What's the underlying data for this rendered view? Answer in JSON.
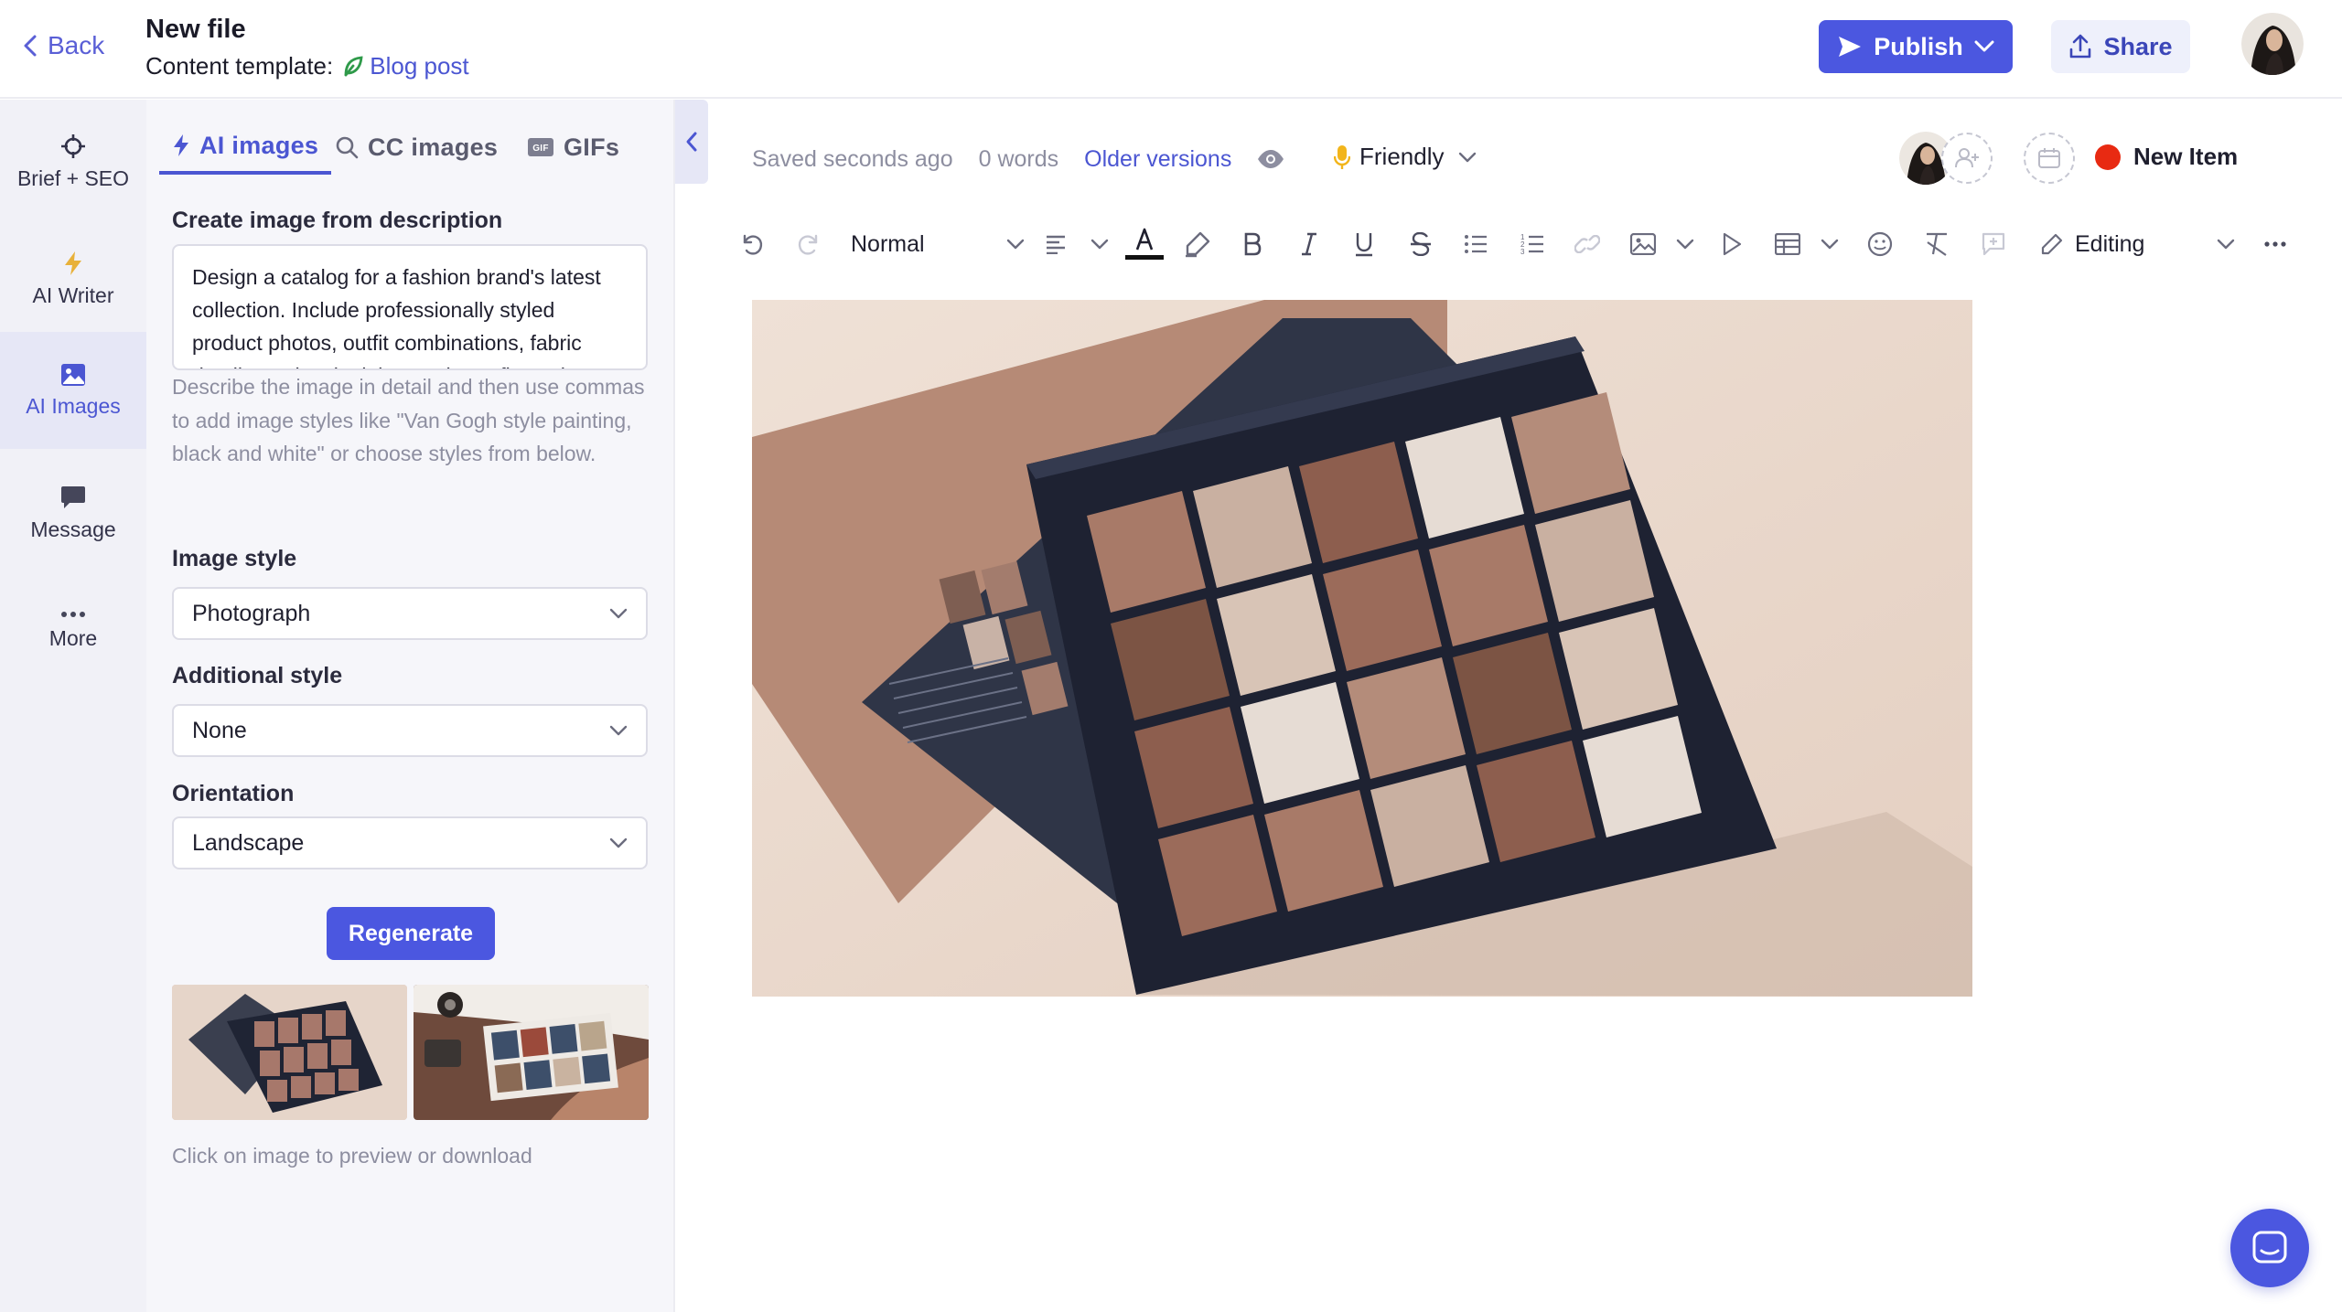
{
  "header": {
    "back_label": "Back",
    "file_title": "New file",
    "template_label": "Content template:",
    "template_name": "Blog post",
    "publish_label": "Publish",
    "share_label": "Share"
  },
  "leftnav": {
    "items": [
      {
        "label": "Brief + SEO",
        "icon": "crosshair-icon"
      },
      {
        "label": "AI Writer",
        "icon": "lightning-icon"
      },
      {
        "label": "AI Images",
        "icon": "image-icon",
        "active": true
      },
      {
        "label": "Message",
        "icon": "chat-bubble-icon"
      },
      {
        "label": "More",
        "icon": "more-dots-icon"
      }
    ]
  },
  "panel": {
    "tabs": [
      {
        "label": "AI images",
        "icon": "lightning-icon",
        "active": true
      },
      {
        "label": "CC images",
        "icon": "search-icon"
      },
      {
        "label": "GIFs",
        "icon": "gif-icon"
      }
    ],
    "create_label": "Create image from description",
    "description_value": "Design a catalog for a fashion brand's latest collection. Include professionally styled product photos, outfit combinations, fabric details, and a sleek layout that reflects the",
    "hint": "Describe the image in detail and then use commas to add image styles like \"Van Gogh style painting, black and white\" or choose styles from below.",
    "image_style_label": "Image style",
    "image_style_value": "Photograph",
    "additional_style_label": "Additional style",
    "additional_style_value": "None",
    "orientation_label": "Orientation",
    "orientation_value": "Landscape",
    "regenerate_label": "Regenerate",
    "click_hint": "Click on image to preview or download"
  },
  "editor": {
    "saved_status": "Saved seconds ago",
    "word_count": "0 words",
    "older_versions": "Older versions",
    "tone": "Friendly",
    "new_item_label": "New Item",
    "text_style": "Normal",
    "mode": "Editing"
  },
  "colors": {
    "accent": "#4b57e0",
    "accent_text": "#4b56d2",
    "status_red": "#e82a12",
    "nav_bg": "#f1f1f7",
    "panel_bg": "#f6f6fa"
  }
}
